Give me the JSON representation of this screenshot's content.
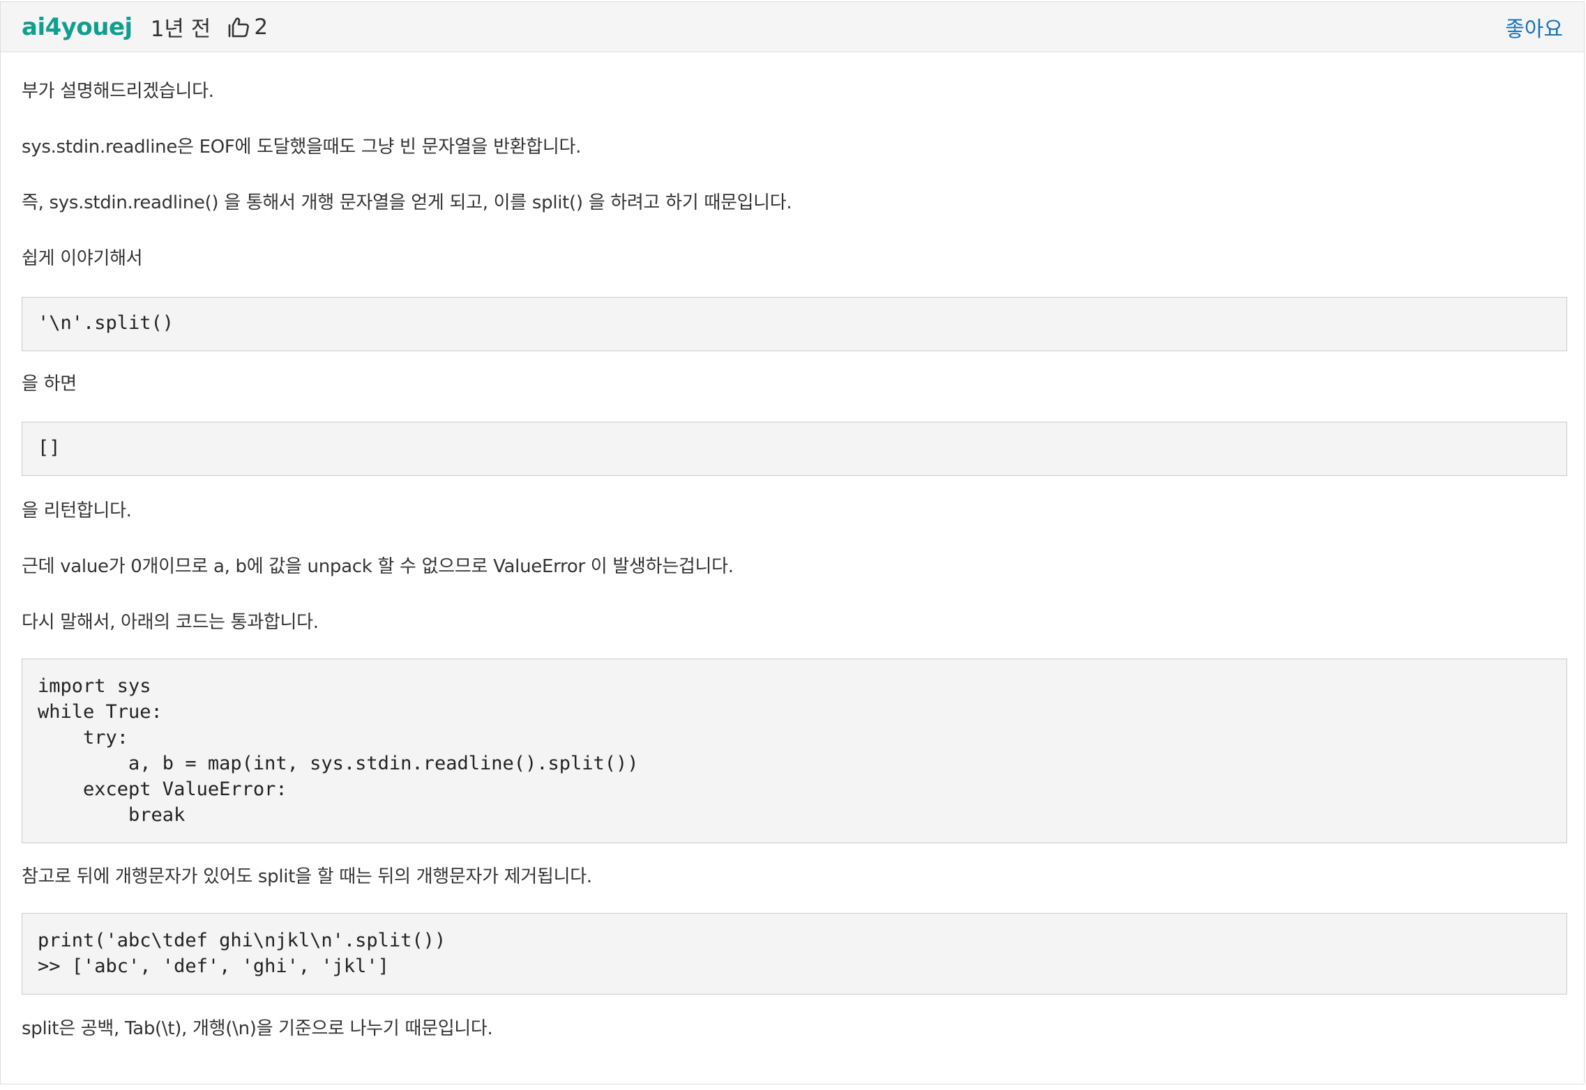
{
  "comment": {
    "author": "ai4youej",
    "time": "1년 전",
    "likes": "2",
    "like_button": "좋아요",
    "icons": {
      "thumbs_up": "thumbs-up-icon"
    },
    "colors": {
      "author": "#0f9f8e",
      "link": "#1a73b8",
      "code_bg": "#f4f4f4"
    },
    "body": {
      "p1": "부가 설명해드리겠습니다.",
      "p2": "sys.stdin.readline은 EOF에 도달했을때도 그냥 빈 문자열을 반환합니다.",
      "p3": "즉, sys.stdin.readline() 을 통해서 개행 문자열을 얻게 되고, 이를 split() 을 하려고 하기 때문입니다.",
      "p4": "쉽게 이야기해서",
      "code1": "'\\n'.split()",
      "p5": "을 하면",
      "code2": "[]",
      "p6": "을 리턴합니다.",
      "p7": "근데 value가 0개이므로 a, b에 값을 unpack 할 수 없으므로 ValueError 이 발생하는겁니다.",
      "p8": "다시 말해서, 아래의 코드는 통과합니다.",
      "code3": "import sys\nwhile True:\n    try:\n        a, b = map(int, sys.stdin.readline().split())\n    except ValueError:\n        break",
      "p9": "참고로 뒤에 개행문자가 있어도 split을 할 때는 뒤의 개행문자가 제거됩니다.",
      "code4": "print('abc\\tdef ghi\\njkl\\n'.split())\n>> ['abc', 'def', 'ghi', 'jkl']",
      "p10": "split은 공백, Tab(\\t), 개행(\\n)을 기준으로 나누기 때문입니다."
    }
  }
}
